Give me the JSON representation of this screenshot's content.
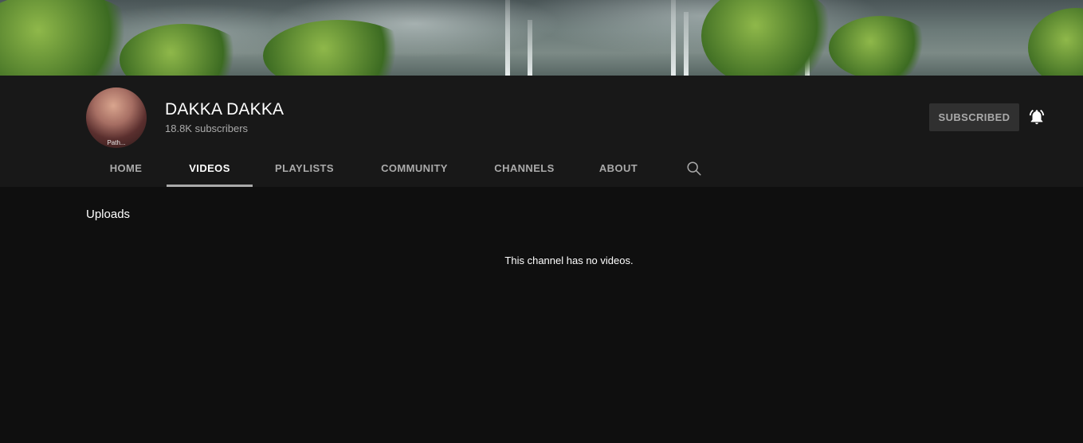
{
  "channel": {
    "name": "DAKKA DAKKA",
    "subscribers": "18.8K subscribers",
    "avatar_caption": "Path..."
  },
  "actions": {
    "subscribe_label": "SUBSCRIBED",
    "bell_icon": "bell-filled-icon"
  },
  "tabs": [
    {
      "label": "HOME",
      "active": false
    },
    {
      "label": "VIDEOS",
      "active": true
    },
    {
      "label": "PLAYLISTS",
      "active": false
    },
    {
      "label": "COMMUNITY",
      "active": false
    },
    {
      "label": "CHANNELS",
      "active": false
    },
    {
      "label": "ABOUT",
      "active": false
    }
  ],
  "search_icon": "search-icon",
  "content": {
    "section_title": "Uploads",
    "empty_message": "This channel has no videos."
  },
  "colors": {
    "background": "#0f0f0f",
    "header_background": "#181818",
    "button_background": "#303030",
    "muted_text": "#aaaaaa"
  }
}
